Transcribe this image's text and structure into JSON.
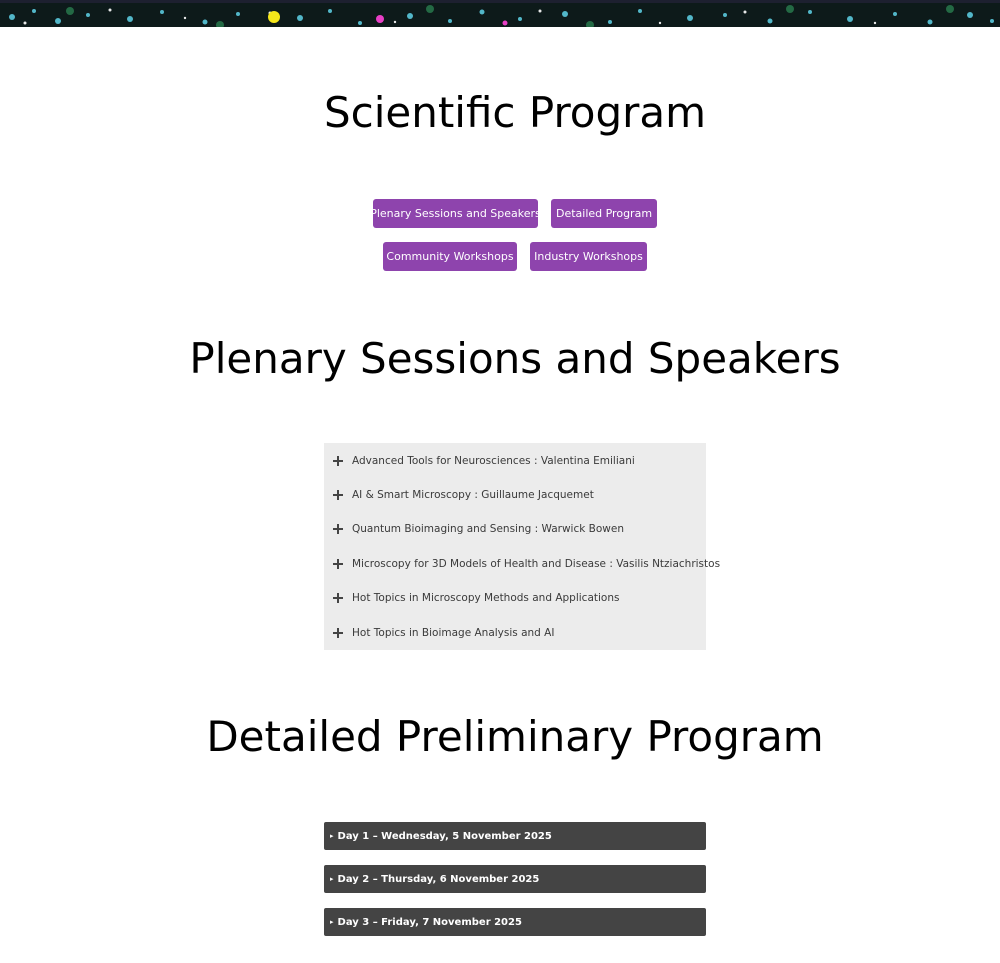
{
  "page_title": "Scientific Program",
  "nav_buttons": {
    "plenary": "Plenary Sessions and Speakers",
    "detailed": "Detailed Program",
    "community": "Community Workshops",
    "industry": "Industry Workshops"
  },
  "plenary": {
    "heading": "Plenary Sessions and Speakers",
    "items": [
      "Advanced Tools for Neurosciences : Valentina Emiliani",
      "AI & Smart Microscopy : Guillaume Jacquemet",
      "Quantum Bioimaging and Sensing : Warwick Bowen",
      "Microscopy for 3D Models of Health and Disease : Vasilis Ntziachristos",
      "Hot Topics in Microscopy Methods and Applications",
      "Hot Topics in Bioimage Analysis and AI"
    ]
  },
  "detailed": {
    "heading": "Detailed Preliminary Program",
    "marker": "▸",
    "days": [
      "Day 1 – Wednesday, 5 November 2025",
      "Day 2 – Thursday, 6 November 2025",
      "Day 3 – Friday, 7 November 2025"
    ]
  },
  "colors": {
    "button": "#8e44ad",
    "accordion_bg": "#ececec",
    "day_bar": "#444444"
  },
  "icons": {
    "accordion_expand": "plus-icon",
    "day_expand": "triangle-right-icon"
  }
}
